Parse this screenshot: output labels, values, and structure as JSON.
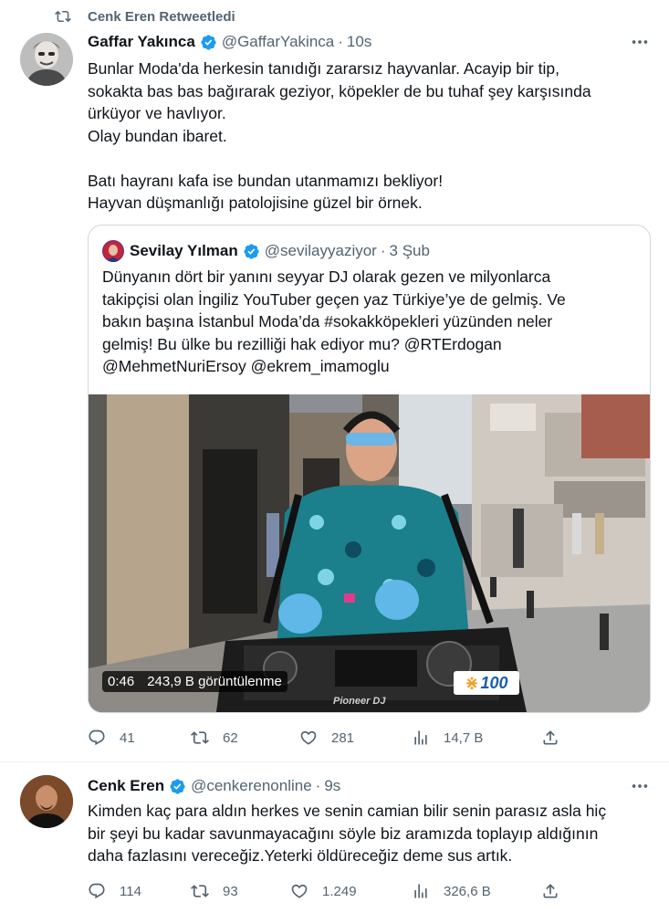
{
  "retweet": {
    "label": "Cenk Eren Retweetledi"
  },
  "tweet1": {
    "name": "Gaffar Yakınca",
    "handle": "@GaffarYakinca",
    "sep": "·",
    "time": "10s",
    "lines": [
      "Bunlar Moda'da herkesin tanıdığı zararsız hayvanlar. Acayip bir tip,",
      "sokakta bas bas bağırarak geziyor, köpekler de bu tuhaf şey karşısında",
      "ürküyor ve havlıyor.",
      "Olay bundan ibaret.",
      "",
      "Batı hayranı kafa ise bundan utanmamızı bekliyor!",
      "Hayvan düşmanlığı patolojisine güzel bir örnek."
    ],
    "stats": {
      "replies": "41",
      "retweets": "62",
      "likes": "281",
      "views": "14,7 B"
    }
  },
  "quote": {
    "name": "Sevilay Yılman",
    "handle": "@sevilayyaziyor",
    "sep": "·",
    "time": "3 Şub",
    "lines": [
      "Dünyanın dört bir yanını seyyar DJ olarak gezen ve milyonlarca",
      "takipçisi olan İngiliz YouTuber geçen yaz Türkiye’ye de gelmiş. Ve",
      "bakın başına İstanbul Moda’da #sokakköpekleri yüzünden neler",
      "gelmiş! Bu ülke bu rezilliği hak ediyor mu? @RTErdogan",
      "@MehmetNuriErsoy @ekrem_imamoglu"
    ],
    "video": {
      "duration": "0:46",
      "views": "243,9 B görüntülenme",
      "watermark": "100",
      "brand": "Pioneer DJ"
    }
  },
  "tweet2": {
    "name": "Cenk Eren",
    "handle": "@cenkerenonline",
    "sep": "·",
    "time": "9s",
    "lines": [
      "Kimden kaç para aldın herkes ve senin camian bilir senin parasız asla hiç",
      "bir şeyi bu kadar savunmayacağını söyle biz aramızda toplayıp aldığının",
      "daha fazlasını vereceğiz.Yeterki öldüreceğiz deme sus artık."
    ],
    "stats": {
      "replies": "114",
      "retweets": "93",
      "likes": "1.249",
      "views": "326,6 B"
    }
  },
  "colors": {
    "verified": "#1d9bf0",
    "text": "#0f1419",
    "muted": "#536471",
    "border": "#cfd9de"
  },
  "icons": [
    "retweet-icon",
    "verified-badge-icon",
    "more-icon",
    "reply-icon",
    "like-icon",
    "views-icon",
    "share-icon"
  ]
}
